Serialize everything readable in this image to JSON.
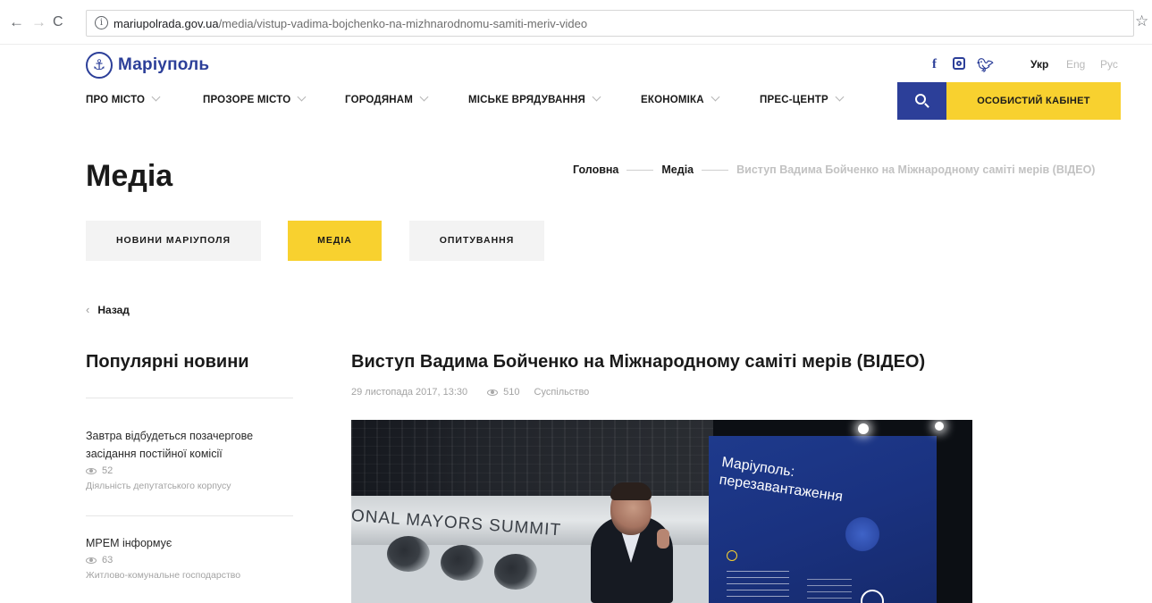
{
  "browser": {
    "url_host": "mariupolrada.gov.ua",
    "url_path": "/media/vistup-vadima-bojchenko-na-mizhnarodnomu-samiti-meriv-video"
  },
  "header": {
    "logo_text": "Маріуполь",
    "social": [
      "facebook-icon",
      "instagram-icon",
      "twitter-icon"
    ],
    "languages": [
      "Укр",
      "Eng",
      "Рус"
    ],
    "active_language": "Укр",
    "nav": [
      "ПРО МІСТО",
      "ПРОЗОРЕ МІСТО",
      "ГОРОДЯНАМ",
      "МІСЬКЕ ВРЯДУВАННЯ",
      "ЕКОНОМІКА",
      "ПРЕС-ЦЕНТР"
    ],
    "cabinet_label": "ОСОБИСТИЙ КАБІНЕТ",
    "colors": {
      "brand_blue": "#2c3f99",
      "accent_yellow": "#f8d12f"
    }
  },
  "page": {
    "title": "Медіа",
    "breadcrumb": [
      "Головна",
      "Медіа",
      "Виступ Вадима Бойченко на Міжнародному саміті мерів (ВІДЕО)"
    ],
    "tabs": [
      "НОВИНИ МАРІУПОЛЯ",
      "МЕДІА",
      "ОПИТУВАННЯ"
    ],
    "active_tab": "МЕДІА",
    "back_label": "Назад"
  },
  "sidebar": {
    "title": "Популярні новини",
    "items": [
      {
        "title": "Завтра відбудеться позачергове засідання постійної комісії",
        "views": "52",
        "category": "Діяльність депутатського корпусу"
      },
      {
        "title": "МРЕМ інформує",
        "views": "63",
        "category": "Житлово-комунальне господарство"
      }
    ]
  },
  "article": {
    "title": "Виступ Вадима Бойченко на Міжнародному саміті мерів (ВІДЕО)",
    "date": "29 листопада 2017, 13:30",
    "views": "510",
    "category": "Суспільство",
    "video": {
      "banner_text": "ONAL MAYORS SUMMIT",
      "screen_title_1": "Маріуполь:",
      "screen_title_2": "перезавантаження"
    }
  }
}
